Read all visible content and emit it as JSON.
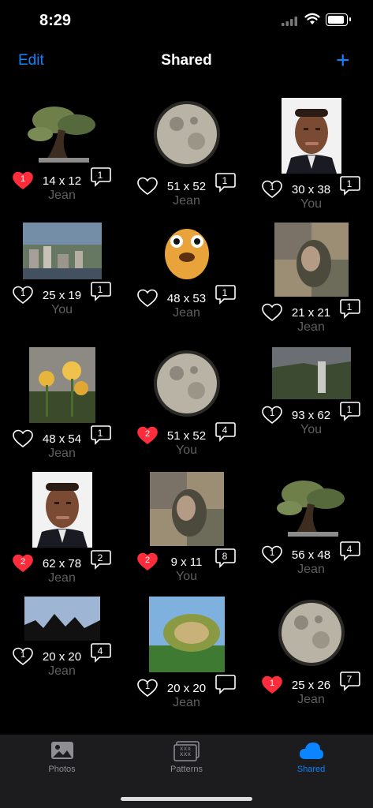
{
  "status": {
    "time": "8:29"
  },
  "nav": {
    "edit_label": "Edit",
    "title": "Shared",
    "add_label": "+"
  },
  "accent": "#0a84ff",
  "heart_red": "#ff2d3b",
  "patterns": [
    {
      "dims": "14 x 12",
      "owner": "Jean",
      "likes": "1",
      "liked": true,
      "comments": "1",
      "thumb": "bonsai"
    },
    {
      "dims": "51 x 52",
      "owner": "Jean",
      "likes": "",
      "liked": false,
      "comments": "1",
      "thumb": "moon"
    },
    {
      "dims": "30 x 38",
      "owner": "You",
      "likes": "1",
      "liked": false,
      "comments": "1",
      "thumb": "portrait"
    },
    {
      "dims": "25 x 19",
      "owner": "You",
      "likes": "1",
      "liked": false,
      "comments": "1",
      "thumb": "city"
    },
    {
      "dims": "48 x 53",
      "owner": "Jean",
      "likes": "",
      "liked": false,
      "comments": "1",
      "thumb": "dog"
    },
    {
      "dims": "21 x 21",
      "owner": "Jean",
      "likes": "",
      "liked": false,
      "comments": "1",
      "thumb": "mosaic"
    },
    {
      "dims": "48 x 54",
      "owner": "Jean",
      "likes": "",
      "liked": false,
      "comments": "1",
      "thumb": "daffodil"
    },
    {
      "dims": "51 x 52",
      "owner": "You",
      "likes": "2",
      "liked": true,
      "comments": "4",
      "thumb": "moon"
    },
    {
      "dims": "93 x 62",
      "owner": "You",
      "likes": "1",
      "liked": false,
      "comments": "1",
      "thumb": "waterfall"
    },
    {
      "dims": "62 x 78",
      "owner": "Jean",
      "likes": "2",
      "liked": true,
      "comments": "2",
      "thumb": "portrait"
    },
    {
      "dims": "9 x 11",
      "owner": "You",
      "likes": "2",
      "liked": true,
      "comments": "8",
      "thumb": "mosaic"
    },
    {
      "dims": "56 x 48",
      "owner": "Jean",
      "likes": "1",
      "liked": false,
      "comments": "4",
      "thumb": "bonsai"
    },
    {
      "dims": "20 x 20",
      "owner": "Jean",
      "likes": "1",
      "liked": false,
      "comments": "4",
      "thumb": "skyline"
    },
    {
      "dims": "20 x 20",
      "owner": "Jean",
      "likes": "1",
      "liked": false,
      "comments": "",
      "thumb": "landscape"
    },
    {
      "dims": "25 x 26",
      "owner": "Jean",
      "likes": "1",
      "liked": true,
      "comments": "7",
      "thumb": "moon"
    }
  ],
  "tabs": [
    {
      "label": "Photos",
      "icon": "photo-icon",
      "active": false
    },
    {
      "label": "Patterns",
      "icon": "patterns-icon",
      "active": false
    },
    {
      "label": "Shared",
      "icon": "cloud-icon",
      "active": true
    }
  ]
}
